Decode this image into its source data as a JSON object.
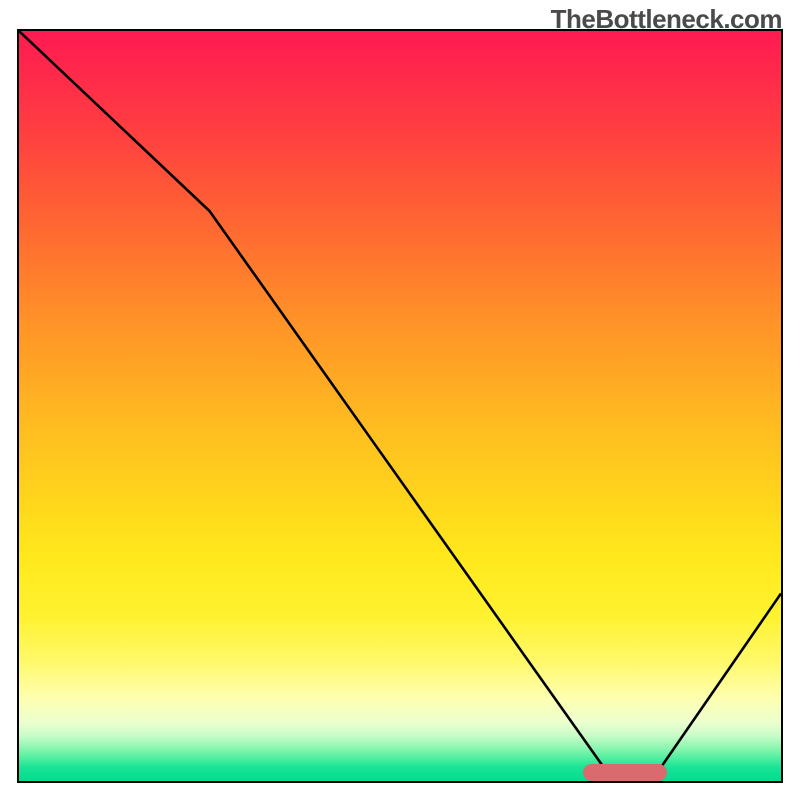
{
  "watermark": "TheBottleneck.com",
  "chart_data": {
    "type": "line",
    "title": "",
    "xlabel": "",
    "ylabel": "",
    "x": [
      0,
      25,
      78,
      83,
      100
    ],
    "values": [
      100,
      76,
      0,
      0,
      25
    ],
    "marker": {
      "x_start": 74,
      "x_end": 85,
      "y": 0
    },
    "background": {
      "type": "vertical-gradient",
      "stops": [
        {
          "pos": 0,
          "color": "#ff1a52"
        },
        {
          "pos": 50,
          "color": "#ffb022"
        },
        {
          "pos": 80,
          "color": "#fff230"
        },
        {
          "pos": 100,
          "color": "#00dd91"
        }
      ]
    },
    "xlim": [
      0,
      100
    ],
    "ylim": [
      0,
      100
    ]
  }
}
